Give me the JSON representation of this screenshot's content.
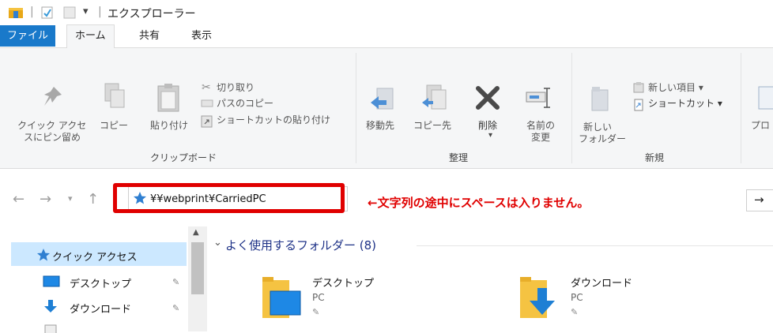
{
  "window": {
    "title": "エクスプローラー"
  },
  "quick_access_toolbar": {
    "separator": "|",
    "customize_glyph": "▾"
  },
  "tabs": [
    {
      "label": "ファイル"
    },
    {
      "label": "ホーム"
    },
    {
      "label": "共有"
    },
    {
      "label": "表示"
    }
  ],
  "ribbon": {
    "clipboard": {
      "group_label": "クリップボード",
      "pin_label_1": "クイック アクセ",
      "pin_label_2": "スにピン留め",
      "copy_label": "コピー",
      "paste_label": "貼り付け",
      "cut_label": "切り取り",
      "copy_path_label": "パスのコピー",
      "paste_shortcut_label": "ショートカットの貼り付け"
    },
    "organize": {
      "group_label": "整理",
      "move_to_label": "移動先",
      "copy_to_label": "コピー先",
      "delete_label": "削除",
      "rename_label_1": "名前の",
      "rename_label_2": "変更"
    },
    "new": {
      "group_label": "新規",
      "new_folder_label_1": "新しい",
      "new_folder_label_2": "フォルダー",
      "new_item_label": "新しい項目 ▾",
      "easy_access_label": "ショートカット ▾"
    },
    "open": {
      "properties_label": "プロ"
    }
  },
  "address_bar": {
    "path": "¥¥webprint¥CarriedPC",
    "go_glyph": "→",
    "annotation": "←文字列の途中にスペースは入りません。"
  },
  "nav_pane": {
    "items": [
      {
        "label": "クイック アクセス"
      },
      {
        "label": "デスクトップ"
      },
      {
        "label": "ダウンロード"
      }
    ]
  },
  "content": {
    "section_title": "よく使用するフォルダー (8)",
    "tiles": [
      {
        "name": "デスクトップ",
        "location": "PC"
      },
      {
        "name": "ダウンロード",
        "location": "PC"
      }
    ]
  },
  "colors": {
    "accent": "#1979ca",
    "highlight": "#e00000",
    "selection": "#cce8ff"
  }
}
